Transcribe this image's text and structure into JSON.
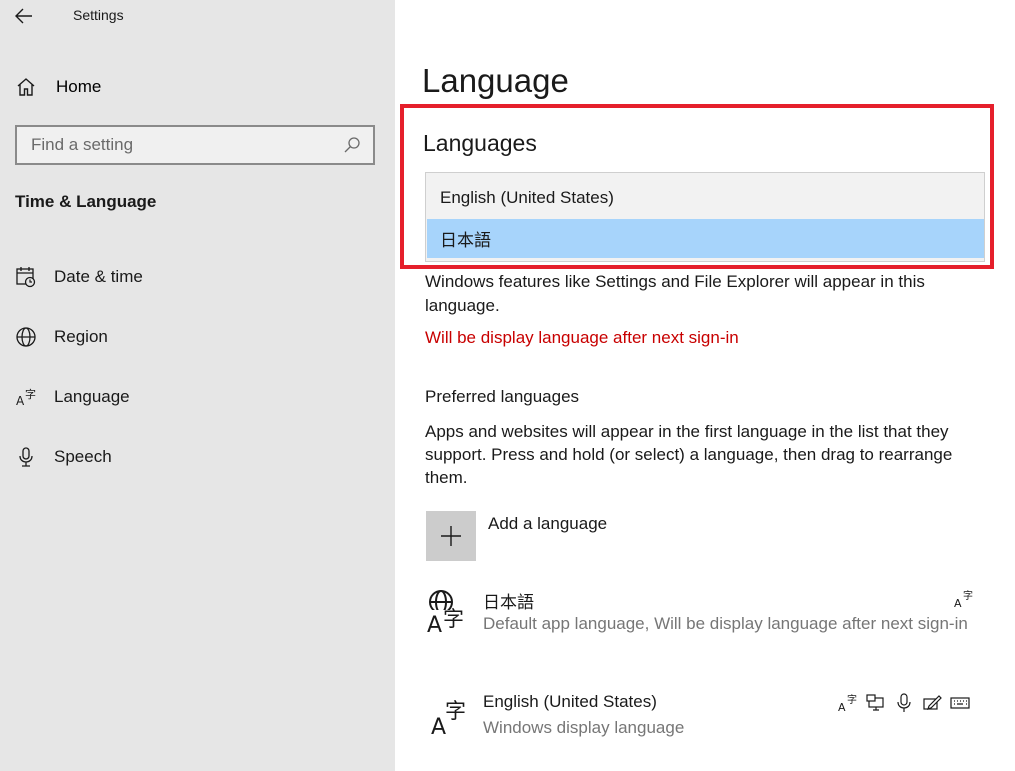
{
  "app": {
    "title": "Settings"
  },
  "sidebar": {
    "home_label": "Home",
    "search_placeholder": "Find a setting",
    "section_title": "Time & Language",
    "items": [
      {
        "label": "Date & time",
        "icon": "calendar-clock-icon"
      },
      {
        "label": "Region",
        "icon": "globe-icon"
      },
      {
        "label": "Language",
        "icon": "language-icon"
      },
      {
        "label": "Speech",
        "icon": "microphone-icon"
      }
    ]
  },
  "main": {
    "page_title": "Language",
    "languages_heading": "Languages",
    "dropdown_options": [
      {
        "label": "English (United States)",
        "selected": false
      },
      {
        "label": "日本語",
        "selected": true
      }
    ],
    "display_description": "Windows features like Settings and File Explorer will appear in this language.",
    "pending_notice": "Will be display language after next sign-in",
    "preferred_heading": "Preferred languages",
    "preferred_description": "Apps and websites will appear in the first language in the list that they support. Press and hold (or select) a language, then drag to rearrange them.",
    "add_language_label": "Add a language",
    "preferred_list": [
      {
        "name": "日本語",
        "subtitle": "Default app language, Will be display language after next sign-in",
        "features": [
          "language-pack-icon"
        ]
      },
      {
        "name": "English (United States)",
        "subtitle": "Windows display language",
        "features": [
          "language-pack-icon",
          "display-icon",
          "microphone-icon",
          "handwriting-icon",
          "keyboard-icon"
        ]
      }
    ]
  },
  "colors": {
    "highlight_border": "#e51f2b",
    "selected_option": "#a7d4fb",
    "warning_text": "#c80000",
    "sidebar_bg": "#e6e6e6"
  }
}
